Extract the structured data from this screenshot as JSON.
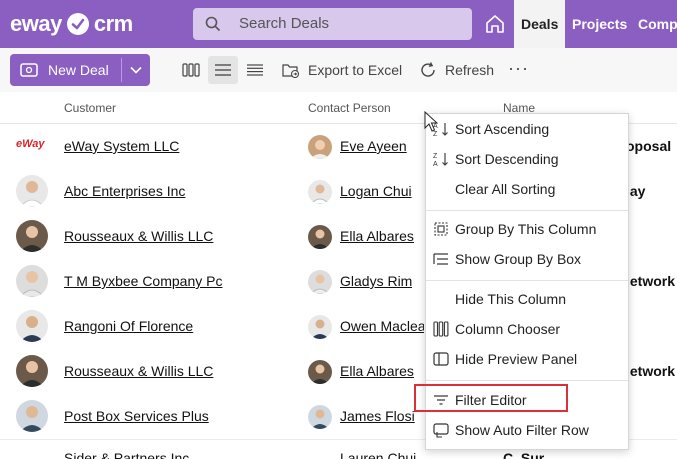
{
  "app": {
    "logo_left": "eway",
    "logo_right": "crm",
    "brand_color": "#8b5fc1"
  },
  "search": {
    "placeholder": "Search Deals"
  },
  "nav": {
    "items": [
      {
        "label": "Deals",
        "active": true
      },
      {
        "label": "Projects",
        "active": false
      },
      {
        "label": "Compa",
        "active": false
      }
    ]
  },
  "toolbar": {
    "new_deal_label": "New Deal",
    "export_label": "Export to Excel",
    "refresh_label": "Refresh",
    "more_label": "···"
  },
  "grid": {
    "columns": [
      "Customer",
      "Contact Person",
      "Name"
    ],
    "rows": [
      {
        "customer": "eWay System LLC",
        "customer_logo": "eWay",
        "contact": "Eve Ayeen",
        "name": "oposal"
      },
      {
        "customer": "Abc Enterprises Inc",
        "contact": "Logan Chui",
        "name": "lay"
      },
      {
        "customer": "Rousseaux & Willis LLC",
        "contact": "Ella Albares",
        "name": ""
      },
      {
        "customer": "T M Byxbee Company Pc",
        "contact": "Gladys Rim",
        "name": "letwork"
      },
      {
        "customer": "Rangoni Of Florence",
        "contact": "Owen Maclea",
        "name": ""
      },
      {
        "customer": "Rousseaux & Willis LLC",
        "contact": "Ella Albares",
        "name": "letwork"
      },
      {
        "customer": "Post Box Services Plus",
        "contact": "James Flosi",
        "name": ""
      },
      {
        "customer": "Sider & Partners Inc",
        "contact": "Lauren Chui",
        "name": "C. Sur"
      }
    ]
  },
  "context_menu": {
    "items": [
      {
        "label": "Sort Ascending",
        "icon": "sort-ascending-icon"
      },
      {
        "label": "Sort Descending",
        "icon": "sort-descending-icon"
      },
      {
        "label": "Clear All Sorting",
        "icon": ""
      },
      {
        "label": "Group By This Column",
        "icon": "group-by-column-icon"
      },
      {
        "label": "Show Group By Box",
        "icon": "group-by-box-icon"
      },
      {
        "label": "Hide This Column",
        "icon": ""
      },
      {
        "label": "Column Chooser",
        "icon": "column-chooser-icon"
      },
      {
        "label": "Hide Preview Panel",
        "icon": "preview-panel-icon"
      },
      {
        "label": "Filter Editor",
        "icon": "filter-icon",
        "highlighted": true
      },
      {
        "label": "Show Auto Filter Row",
        "icon": "auto-filter-row-icon"
      }
    ],
    "highlight_color": "#d9303a"
  }
}
